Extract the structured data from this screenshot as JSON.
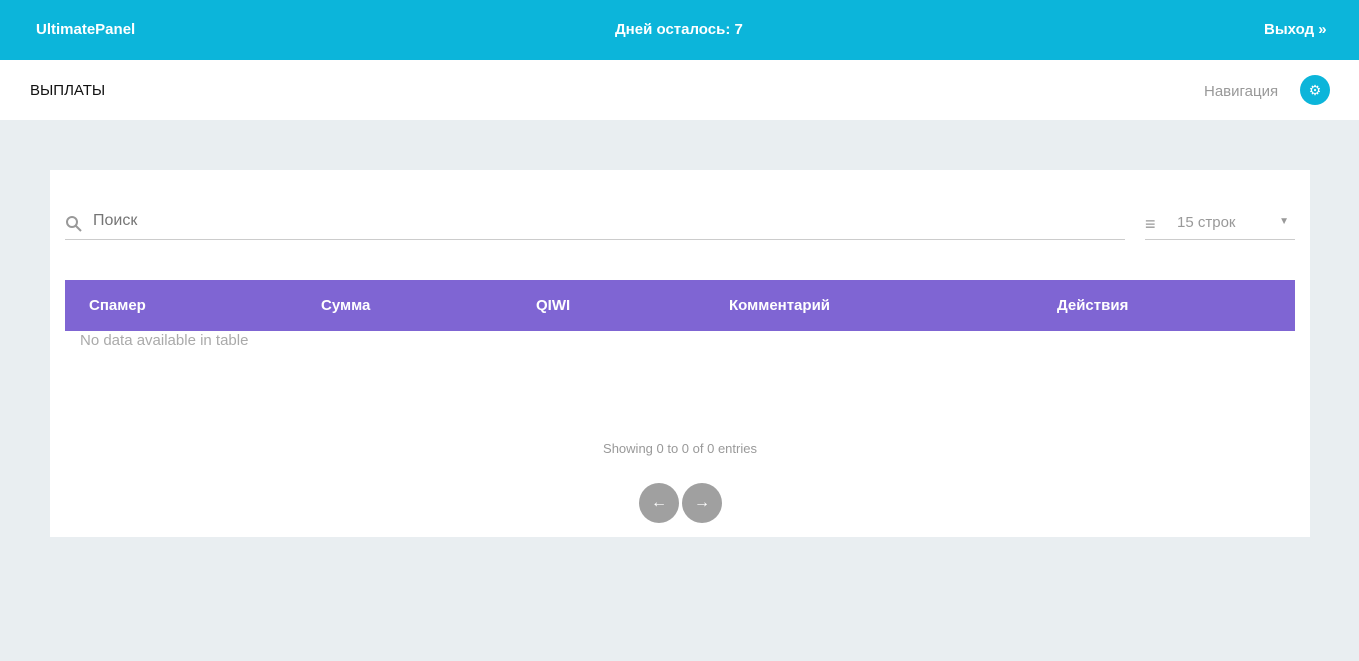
{
  "header": {
    "brand": "UltimatePanel",
    "days_left": "Дней осталось: 7",
    "logout": "Выход »"
  },
  "subheader": {
    "title": "ВЫПЛАТЫ",
    "nav": "Навигация"
  },
  "table": {
    "search_placeholder": "Поиск",
    "rows_select": "15 строк",
    "columns": [
      "Спамер",
      "Сумма",
      "QIWI",
      "Комментарий",
      "Действия"
    ],
    "empty": "No data available in table",
    "info": "Showing 0 to 0 of 0 entries",
    "prev": "←",
    "next": "→"
  },
  "colors": {
    "header": "#0cb5da",
    "table_header": "#7f65d3"
  }
}
